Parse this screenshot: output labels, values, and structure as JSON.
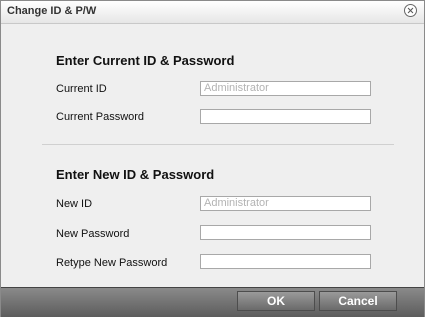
{
  "dialog": {
    "title": "Change ID & P/W",
    "current": {
      "heading": "Enter Current ID & Password",
      "id_label": "Current ID",
      "id_placeholder": "Administrator",
      "password_label": "Current Password",
      "password_value": ""
    },
    "new": {
      "heading": "Enter New ID & Password",
      "id_label": "New ID",
      "id_placeholder": "Administrator",
      "password_label": "New Password",
      "password_value": "",
      "retype_label": "Retype New Password",
      "retype_value": ""
    },
    "buttons": {
      "ok": "OK",
      "cancel": "Cancel"
    },
    "icons": {
      "close": "close-icon"
    }
  }
}
